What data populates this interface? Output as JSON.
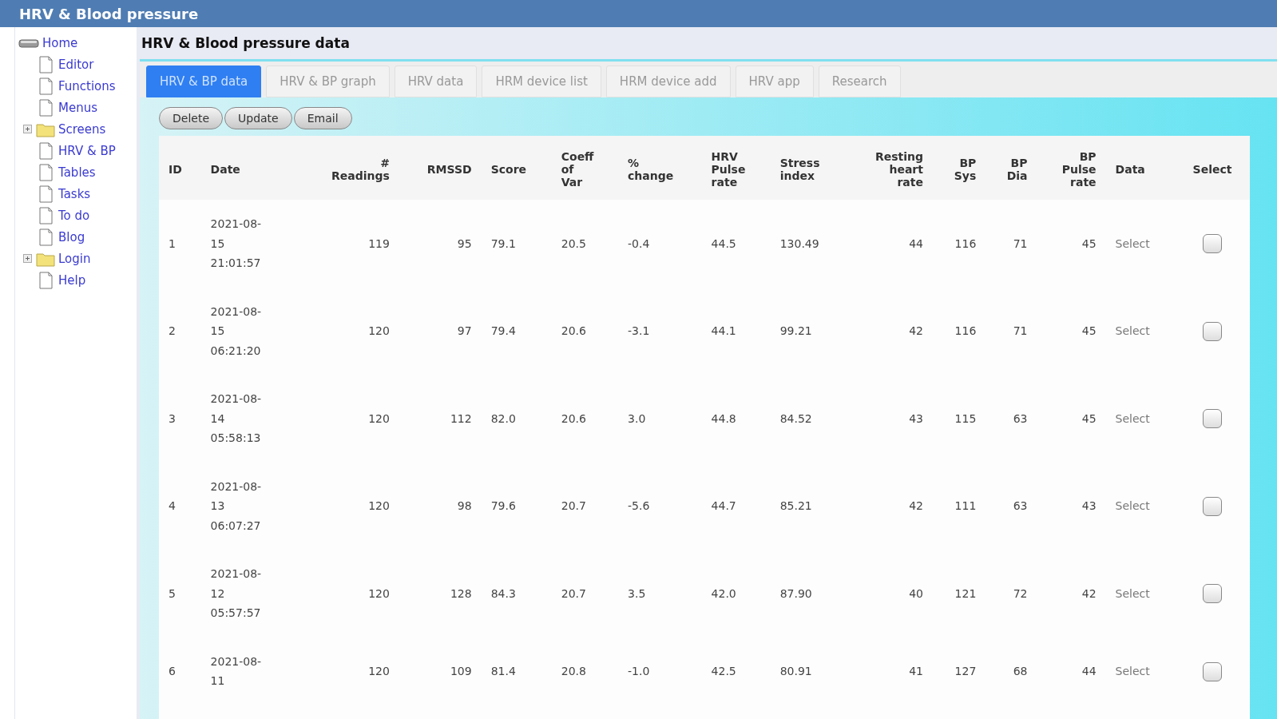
{
  "window": {
    "title": "HRV & Blood pressure"
  },
  "sidebar": {
    "items": [
      {
        "label": "Home",
        "kind": "root",
        "children": [
          {
            "label": "Editor",
            "kind": "page"
          },
          {
            "label": "Functions",
            "kind": "page"
          },
          {
            "label": "Menus",
            "kind": "page"
          },
          {
            "label": "Screens",
            "kind": "folder",
            "expanded": false
          },
          {
            "label": "HRV & BP",
            "kind": "page"
          },
          {
            "label": "Tables",
            "kind": "page"
          },
          {
            "label": "Tasks",
            "kind": "page"
          },
          {
            "label": "To do",
            "kind": "page"
          },
          {
            "label": "Blog",
            "kind": "page"
          },
          {
            "label": "Login",
            "kind": "folder",
            "expanded": false
          },
          {
            "label": "Help",
            "kind": "page"
          }
        ]
      }
    ]
  },
  "page_title": "HRV & Blood pressure data",
  "tabs": [
    {
      "label": "HRV & BP data",
      "selected": true
    },
    {
      "label": "HRV & BP graph",
      "selected": false
    },
    {
      "label": "HRV data",
      "selected": false
    },
    {
      "label": "HRM device list",
      "selected": false
    },
    {
      "label": "HRM device add",
      "selected": false
    },
    {
      "label": "HRV app",
      "selected": false
    },
    {
      "label": "Research",
      "selected": false
    }
  ],
  "buttons": [
    "Delete",
    "Update",
    "Email"
  ],
  "table": {
    "columns": [
      "ID",
      "Date",
      "#\nReadings",
      "RMSSD",
      "Score",
      "Coeff\nof\nVar",
      "%\nchange",
      "HRV\nPulse\nrate",
      "Stress\nindex",
      "Resting\nheart\nrate",
      "BP\nSys",
      "BP\nDia",
      "BP\nPulse\nrate",
      "Data",
      "Select"
    ],
    "rows": [
      {
        "cells": [
          "1",
          "2021-08-15 21:01:57",
          "119",
          "95",
          "79.1",
          "20.5",
          "-0.4",
          "44.5",
          "130.49",
          "44",
          "116",
          "71",
          "45"
        ],
        "link": "Select",
        "checked": false
      },
      {
        "cells": [
          "2",
          "2021-08-15 06:21:20",
          "120",
          "97",
          "79.4",
          "20.6",
          "-3.1",
          "44.1",
          "99.21",
          "42",
          "116",
          "71",
          "45"
        ],
        "link": "Select",
        "checked": false
      },
      {
        "cells": [
          "3",
          "2021-08-14 05:58:13",
          "120",
          "112",
          "82.0",
          "20.6",
          "3.0",
          "44.8",
          "84.52",
          "43",
          "115",
          "63",
          "45"
        ],
        "link": "Select",
        "checked": false
      },
      {
        "cells": [
          "4",
          "2021-08-13 06:07:27",
          "120",
          "98",
          "79.6",
          "20.7",
          "-5.6",
          "44.7",
          "85.21",
          "42",
          "111",
          "63",
          "43"
        ],
        "link": "Select",
        "checked": false
      },
      {
        "cells": [
          "5",
          "2021-08-12 05:57:57",
          "120",
          "128",
          "84.3",
          "20.7",
          "3.5",
          "42.0",
          "87.90",
          "40",
          "121",
          "72",
          "42"
        ],
        "link": "Select",
        "checked": false
      },
      {
        "cells": [
          "6",
          "2021-08-11",
          "120",
          "109",
          "81.4",
          "20.8",
          "-1.0",
          "42.5",
          "80.91",
          "41",
          "127",
          "68",
          "44"
        ],
        "link": "Select",
        "checked": false
      }
    ]
  }
}
